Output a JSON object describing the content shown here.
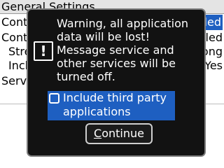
{
  "screen": {
    "title": "General Settings",
    "rows": [
      {
        "label": "Content Compression",
        "value": "Enabled"
      },
      {
        "label": "Content Protection",
        "value": "Disabled"
      },
      {
        "label": "Strength",
        "value": "Strong"
      },
      {
        "label": "Include",
        "value": "Yes"
      },
      {
        "label": "Services:",
        "value": ""
      }
    ]
  },
  "dialog": {
    "icon": "exclamation-icon",
    "message_lines": [
      "Warning, all application",
      "data will be lost!",
      "Message service and",
      "other services will be",
      "turned off."
    ],
    "checkbox": {
      "label_lines": [
        "Include third party",
        "applications"
      ],
      "checked": false
    },
    "continue_button": {
      "first_letter": "C",
      "rest": "ontinue"
    }
  },
  "colors": {
    "highlight": "#1e5fc1",
    "dialog_bg": "#121212"
  }
}
